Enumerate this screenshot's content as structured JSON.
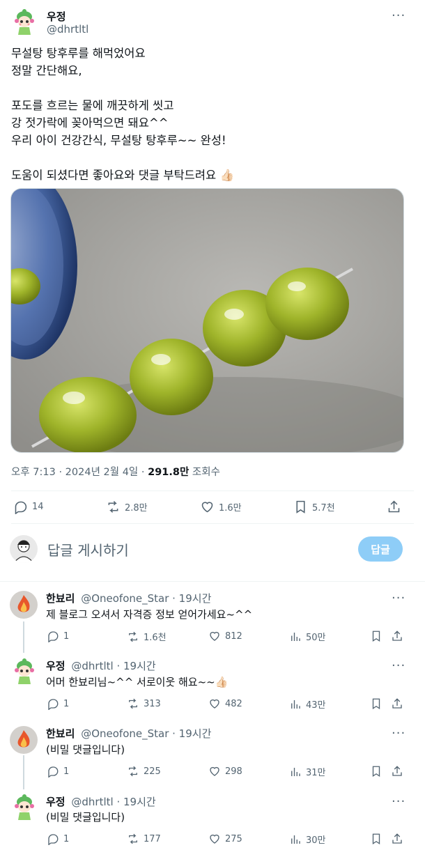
{
  "post": {
    "author_name": "우정",
    "author_handle": "@dhrtltl",
    "more_label": "···",
    "lines": [
      "무설탕 탕후루를 해먹었어요",
      "정말 간단해요,",
      "",
      "포도를 흐르는 물에 깨끗하게 씻고",
      "강 젓가락에 꽂아먹으면 돼요^^",
      "우리 아이 건강간식, 무설탕 탕후루~~ 완성!",
      "",
      "도움이 되셨다면 좋아요와 댓글 부탁드려요 👍🏻"
    ],
    "time": "오후 7:13 · 2024년 2월 4일 · ",
    "views_count": "291.8만",
    "views_label": " 조회수",
    "stats": {
      "replies": "14",
      "reposts": "2.8만",
      "likes": "1.6만",
      "bookmarks": "5.7천"
    }
  },
  "compose": {
    "placeholder": "답글 게시하기",
    "button": "답글"
  },
  "comments": [
    {
      "name": "한뵤리",
      "handle": "@Oneofone_Star",
      "time": " · 19시간",
      "text": "제 블로그 오셔서 자격증 정보 얻어가세요~^^",
      "replies": "1",
      "reposts": "1.6천",
      "likes": "812",
      "views": "50만",
      "avatar": "fire"
    },
    {
      "name": "우정",
      "handle": "@dhrtltl",
      "time": " · 19시간",
      "text": "어머 한뵤리님~^^ 서로이웃 해요~~👍🏻",
      "replies": "1",
      "reposts": "313",
      "likes": "482",
      "views": "43만",
      "avatar": "girl"
    },
    {
      "name": "한뵤리",
      "handle": "@Oneofone_Star",
      "time": " · 19시간",
      "text": "(비밀 댓글입니다)",
      "replies": "1",
      "reposts": "225",
      "likes": "298",
      "views": "31만",
      "avatar": "fire"
    },
    {
      "name": "우정",
      "handle": "@dhrtltl",
      "time": " · 19시간",
      "text": "(비밀 댓글입니다)",
      "replies": "1",
      "reposts": "177",
      "likes": "275",
      "views": "30만",
      "avatar": "girl"
    }
  ]
}
